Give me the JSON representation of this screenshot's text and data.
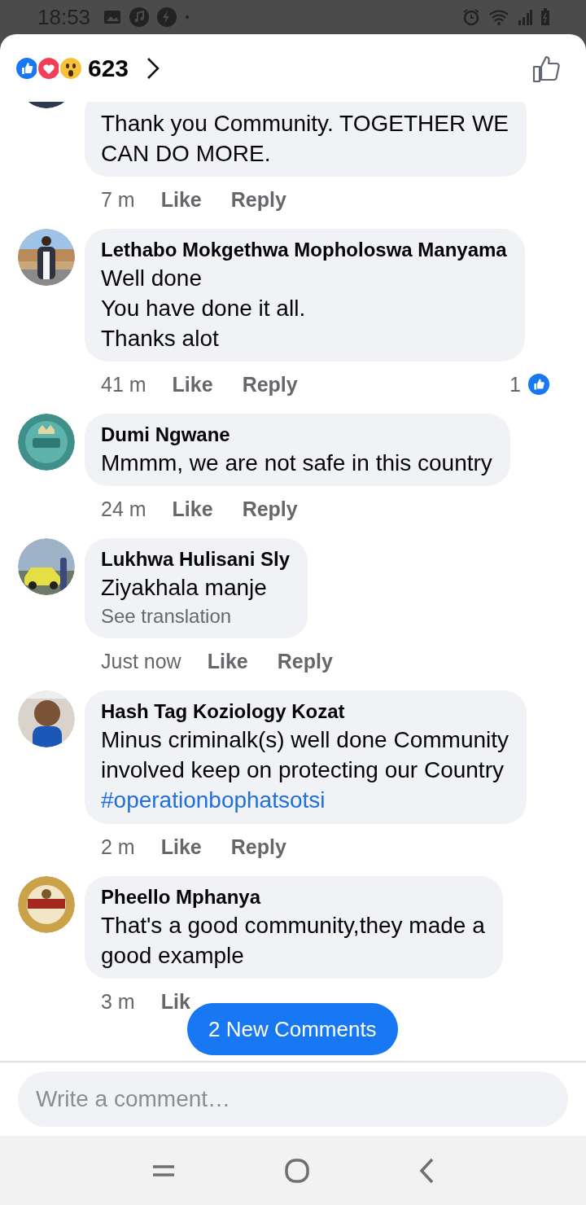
{
  "status_bar": {
    "time": "18:53"
  },
  "header": {
    "reaction_count": "623"
  },
  "comments": [
    {
      "text": "Thank you Community. TOGETHER WE\nCAN DO MORE.",
      "time": "7 m",
      "like": "Like",
      "reply": "Reply"
    },
    {
      "name": "Lethabo Mokgethwa Mopholoswa Manyama",
      "text": "Well done\nYou have done it all.\nThanks alot",
      "time": "41 m",
      "like": "Like",
      "reply": "Reply",
      "likes": "1"
    },
    {
      "name": "Dumi Ngwane",
      "text": "Mmmm, we are not safe in this country",
      "time": "24 m",
      "like": "Like",
      "reply": "Reply"
    },
    {
      "name": "Lukhwa Hulisani Sly",
      "text": "Ziyakhala manje",
      "see_translation": "See translation",
      "time": "Just now",
      "like": "Like",
      "reply": "Reply"
    },
    {
      "name": "Hash Tag Koziology Kozat",
      "text": "Minus criminalk(s) well done Community\ninvolved keep on protecting our Country",
      "hashtag": "#operationbophatsotsi",
      "time": "2 m",
      "like": "Like",
      "reply": "Reply"
    },
    {
      "name": "Pheello Mphanya",
      "text": "That's a good community,they made a\ngood example",
      "time": "3 m",
      "like": "Lik"
    }
  ],
  "new_comments_button": "2 New Comments",
  "composer": {
    "placeholder": "Write a comment…"
  }
}
